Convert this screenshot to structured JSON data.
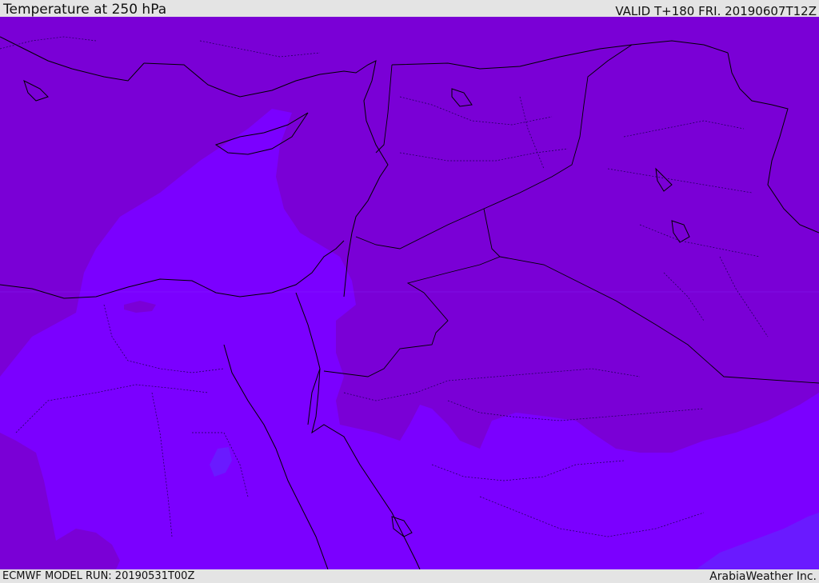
{
  "header": {
    "title": "Temperature at 250 hPa",
    "valid_time": "VALID T+180 FRI. 20190607T12Z"
  },
  "footer": {
    "model_run": "ECMWF MODEL RUN: 20190531T00Z",
    "credit": "ArabiaWeather Inc."
  },
  "map": {
    "colors": {
      "cold_fill": "#7a00d6",
      "warm_fill": "#7b00ff",
      "warmest_fill": "#6a1aff",
      "coastline": "#000000",
      "borders": "#1a0050"
    }
  }
}
